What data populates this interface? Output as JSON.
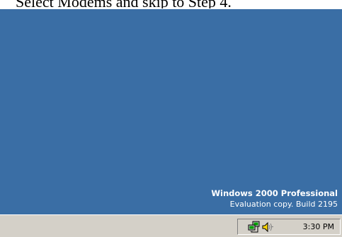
{
  "caption": {
    "text": "Select Modems and skip to Step 4."
  },
  "desktop": {
    "background_color": "#3a6ea5",
    "watermark": {
      "title": "Windows 2000 Professional",
      "subtitle": "Evaluation copy. Build 2195"
    }
  },
  "taskbar": {
    "tray": {
      "icons": [
        "network-modem-icon",
        "volume-icon"
      ],
      "clock": "3:30 PM"
    }
  }
}
